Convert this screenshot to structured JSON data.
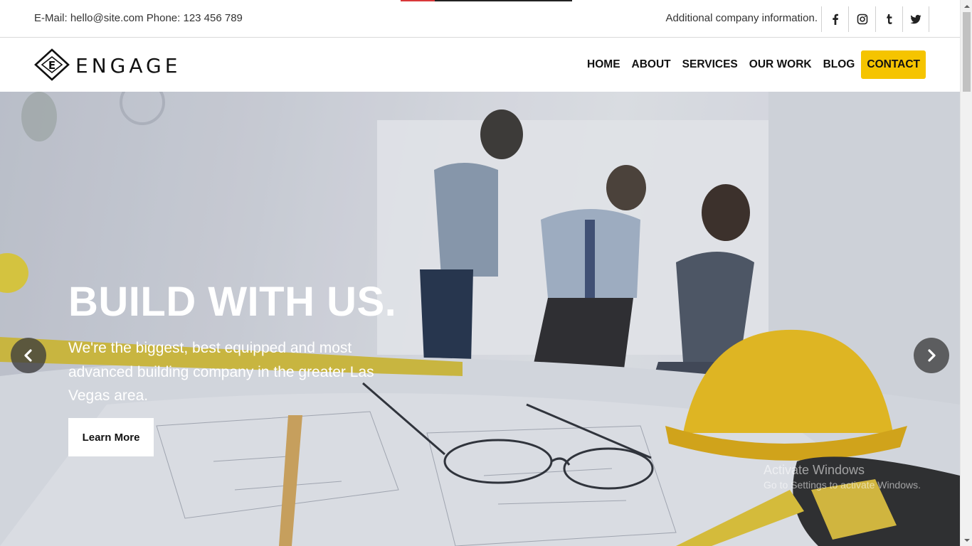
{
  "topbar": {
    "contact": "E-Mail: hello@site.com Phone: 123 456 789",
    "additional": "Additional company information.",
    "social": [
      "facebook-icon",
      "instagram-icon",
      "tumblr-icon",
      "twitter-icon"
    ]
  },
  "nav": {
    "logo_text": "ENGAGE",
    "items": [
      "HOME",
      "ABOUT",
      "SERVICES",
      "OUR WORK",
      "BLOG",
      "CONTACT"
    ],
    "cta_color": "#f5c400"
  },
  "hero": {
    "title": "BUILD WITH US.",
    "text": "We're the biggest, best equipped and most advanced building company in the greater Las Vegas area.",
    "button": "Learn More",
    "prev_icon": "chevron-left-icon",
    "next_icon": "chevron-right-icon"
  },
  "watermark": {
    "line1": "Activate Windows",
    "line2": "Go to Settings to activate Windows."
  }
}
